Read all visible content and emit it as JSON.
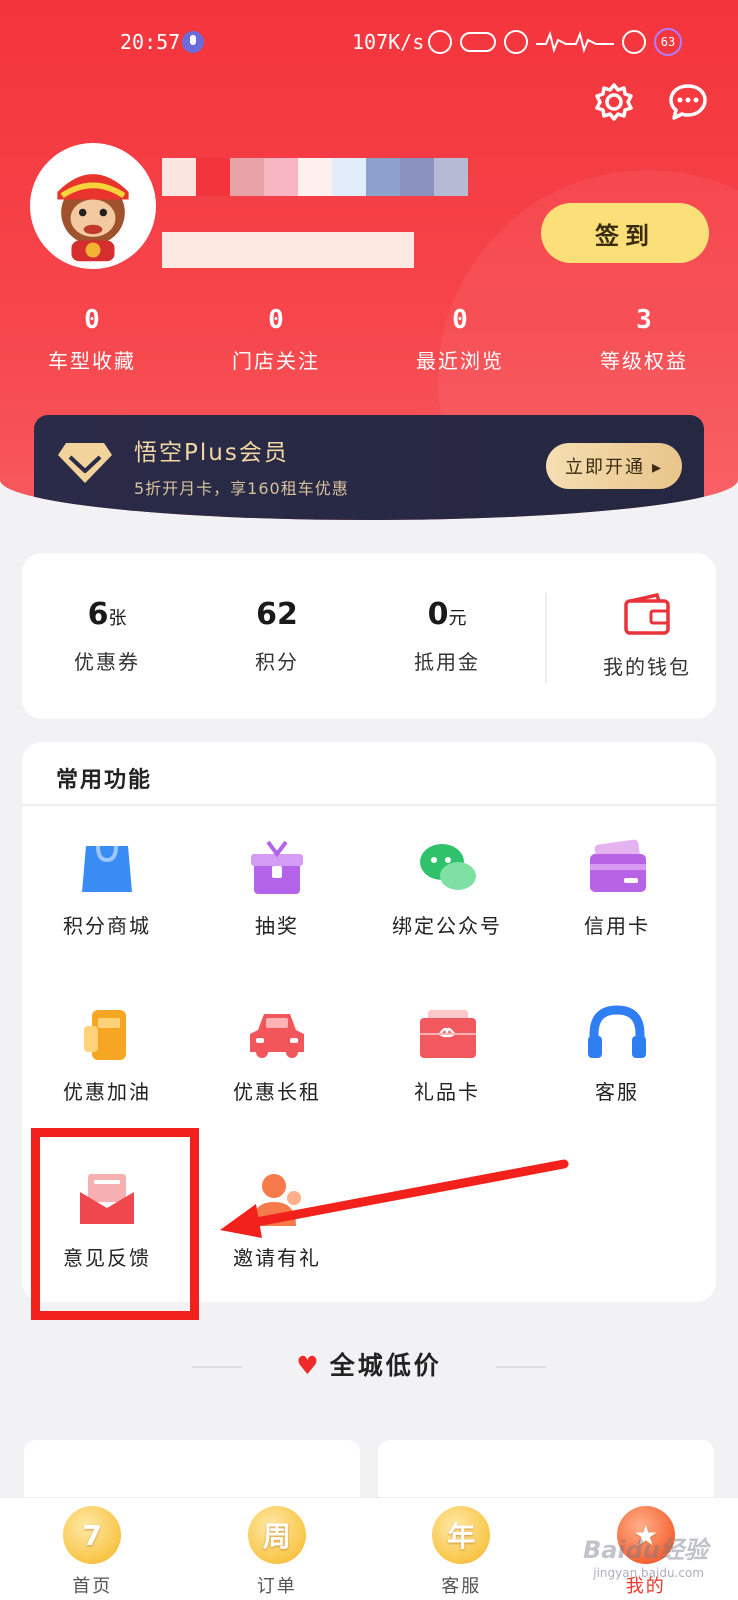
{
  "status_bar": {
    "time": "20:57",
    "speed": "107K/s",
    "battery": "63"
  },
  "header": {
    "settings_icon": "gear-icon",
    "message_icon": "chat-icon",
    "checkin_label": "签到"
  },
  "stats": [
    {
      "value": "0",
      "label": "车型收藏"
    },
    {
      "value": "0",
      "label": "门店关注"
    },
    {
      "value": "0",
      "label": "最近浏览"
    },
    {
      "value": "3",
      "label": "等级权益"
    }
  ],
  "plus": {
    "title": "悟空Plus会员",
    "subtitle": "5折开月卡，享160租车优惠",
    "button": "立即开通 ▸"
  },
  "wallet": {
    "items": [
      {
        "value": "6",
        "unit": "张",
        "label": "优惠券"
      },
      {
        "value": "62",
        "unit": "",
        "label": "积分"
      },
      {
        "value": "0",
        "unit": "元",
        "label": "抵用金"
      }
    ],
    "my_wallet": "我的钱包"
  },
  "functions": {
    "title": "常用功能",
    "items": [
      {
        "label": "积分商城",
        "icon": "shopping-bag-icon"
      },
      {
        "label": "抽奖",
        "icon": "gift-box-icon"
      },
      {
        "label": "绑定公众号",
        "icon": "wechat-icon"
      },
      {
        "label": "信用卡",
        "icon": "credit-card-icon"
      },
      {
        "label": "优惠加油",
        "icon": "fuel-pump-icon"
      },
      {
        "label": "优惠长租",
        "icon": "car-icon"
      },
      {
        "label": "礼品卡",
        "icon": "gift-card-icon"
      },
      {
        "label": "客服",
        "icon": "headset-icon"
      },
      {
        "label": "意见反馈",
        "icon": "envelope-icon"
      },
      {
        "label": "邀请有礼",
        "icon": "person-icon"
      }
    ]
  },
  "section": {
    "title": "全城低价"
  },
  "tabbar": {
    "tabs": [
      {
        "badge": "7",
        "label": "首页"
      },
      {
        "badge": "周",
        "label": "订单"
      },
      {
        "badge": "年",
        "label": "客服"
      },
      {
        "badge": "★",
        "label": "我的"
      }
    ]
  },
  "watermark": {
    "brand": "Baidu经验",
    "url": "jingyan.baidu.com"
  },
  "colors": {
    "brand_red": "#f4343c",
    "checkin_yellow": "#fbe07a",
    "plus_dark": "#2a2b48",
    "highlight_red": "#f2211b"
  }
}
